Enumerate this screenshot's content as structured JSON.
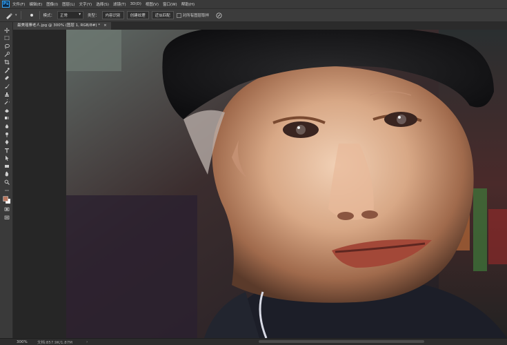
{
  "app": {
    "logo": "Ps"
  },
  "menu": [
    "文件(F)",
    "编辑(E)",
    "图像(I)",
    "图层(L)",
    "文字(Y)",
    "选择(S)",
    "滤镜(T)",
    "3D(D)",
    "视图(V)",
    "窗口(W)",
    "帮助(H)"
  ],
  "options": {
    "mode_label": "模式：",
    "mode_value": "正常",
    "type_label": "类型：",
    "type_buttons": [
      "内容识别",
      "创建纹理",
      "近似匹配"
    ],
    "sample_all_label": "对所有图层取样"
  },
  "document": {
    "tab_title": "最美瑶寨老人.jpg @ 300% (图层 1, RGB/8#) *",
    "close_symbol": "×"
  },
  "status": {
    "zoom": "300%",
    "doc_info": "文档:857.9K/1.87M",
    "arrow": "›"
  },
  "tools": [
    "move-icon",
    "marquee-icon",
    "lasso-icon",
    "quick-select-icon",
    "crop-icon",
    "eyedropper-icon",
    "healing-brush-icon",
    "brush-icon",
    "clone-stamp-icon",
    "history-brush-icon",
    "eraser-icon",
    "gradient-icon",
    "blur-icon",
    "dodge-icon",
    "pen-icon",
    "type-icon",
    "path-select-icon",
    "rectangle-icon",
    "hand-icon",
    "zoom-icon",
    "more-icon",
    "color-swatch-icon",
    "quick-mask-icon",
    "screen-mode-icon"
  ],
  "colors": {
    "foreground": "#b8765e",
    "background": "#ffffff",
    "accent": "#31a8ff"
  }
}
